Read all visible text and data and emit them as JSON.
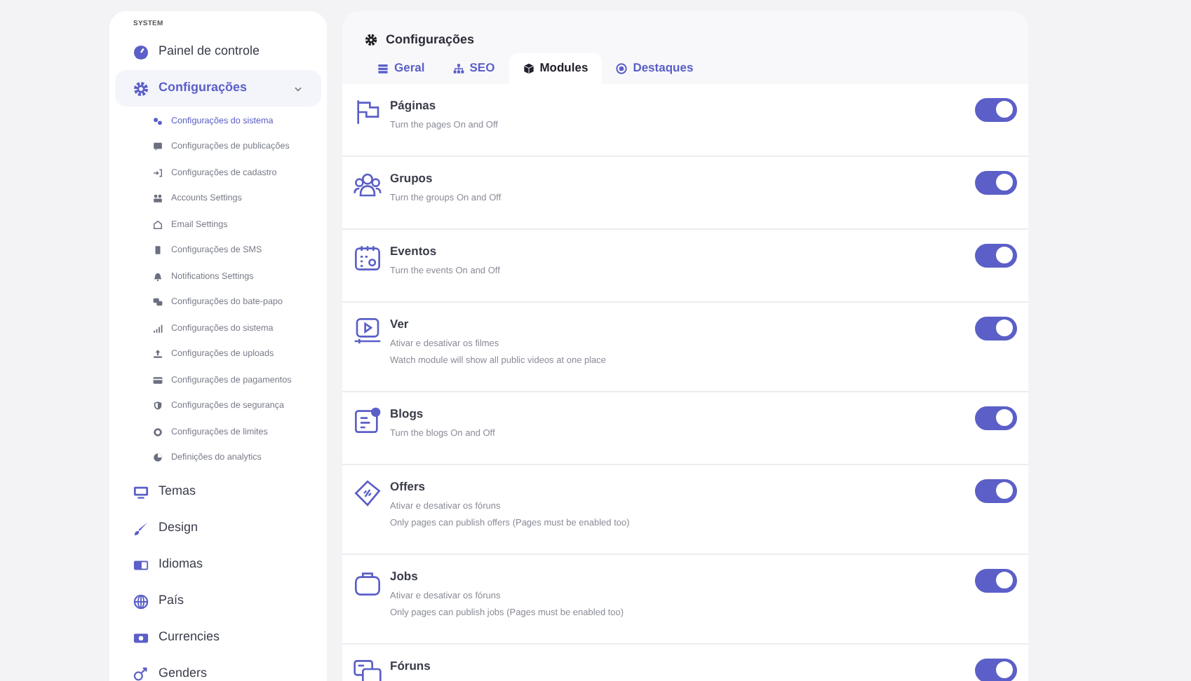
{
  "sidebar": {
    "section_label": "SYSTEM",
    "items": [
      {
        "label": "Painel de controle",
        "selected": false
      },
      {
        "label": "Configurações",
        "selected": true,
        "expanded": true,
        "children": [
          {
            "label": "Configurações do sistema",
            "selected": true
          },
          {
            "label": "Configurações de publicações",
            "selected": false
          },
          {
            "label": "Configurações de cadastro",
            "selected": false
          },
          {
            "label": "Accounts Settings",
            "selected": false
          },
          {
            "label": "Email Settings",
            "selected": false
          },
          {
            "label": "Configurações de SMS",
            "selected": false
          },
          {
            "label": "Notifications Settings",
            "selected": false
          },
          {
            "label": "Configurações do bate-papo",
            "selected": false
          },
          {
            "label": "Configurações do sistema",
            "selected": false
          },
          {
            "label": "Configurações de uploads",
            "selected": false
          },
          {
            "label": "Configurações de pagamentos",
            "selected": false
          },
          {
            "label": "Configurações de segurança",
            "selected": false
          },
          {
            "label": "Configurações de limites",
            "selected": false
          },
          {
            "label": "Definições do analytics",
            "selected": false
          }
        ]
      },
      {
        "label": "Temas",
        "selected": false
      },
      {
        "label": "Design",
        "selected": false
      },
      {
        "label": "Idiomas",
        "selected": false
      },
      {
        "label": "País",
        "selected": false
      },
      {
        "label": "Currencies",
        "selected": false
      },
      {
        "label": "Genders",
        "selected": false
      }
    ]
  },
  "panel": {
    "title": "Configurações",
    "tabs": [
      {
        "label": "Geral",
        "selected": false
      },
      {
        "label": "SEO",
        "selected": false
      },
      {
        "label": "Modules",
        "selected": true
      },
      {
        "label": "Destaques",
        "selected": false
      }
    ],
    "modules": [
      {
        "title": "Páginas",
        "lines": [
          "Turn the pages On and Off"
        ],
        "on": true
      },
      {
        "title": "Grupos",
        "lines": [
          "Turn the groups On and Off"
        ],
        "on": true
      },
      {
        "title": "Eventos",
        "lines": [
          "Turn the events On and Off"
        ],
        "on": true
      },
      {
        "title": "Ver",
        "lines": [
          "Ativar e desativar os filmes",
          "Watch module will show all public videos at one place"
        ],
        "on": true
      },
      {
        "title": "Blogs",
        "lines": [
          "Turn the blogs On and Off"
        ],
        "on": true
      },
      {
        "title": "Offers",
        "lines": [
          "Ativar e desativar os fóruns",
          "Only pages can publish offers (Pages must be enabled too)"
        ],
        "on": true
      },
      {
        "title": "Jobs",
        "lines": [
          "Ativar e desativar os fóruns",
          "Only pages can publish jobs (Pages must be enabled too)"
        ],
        "on": true
      },
      {
        "title": "Fóruns",
        "on": true
      }
    ]
  }
}
